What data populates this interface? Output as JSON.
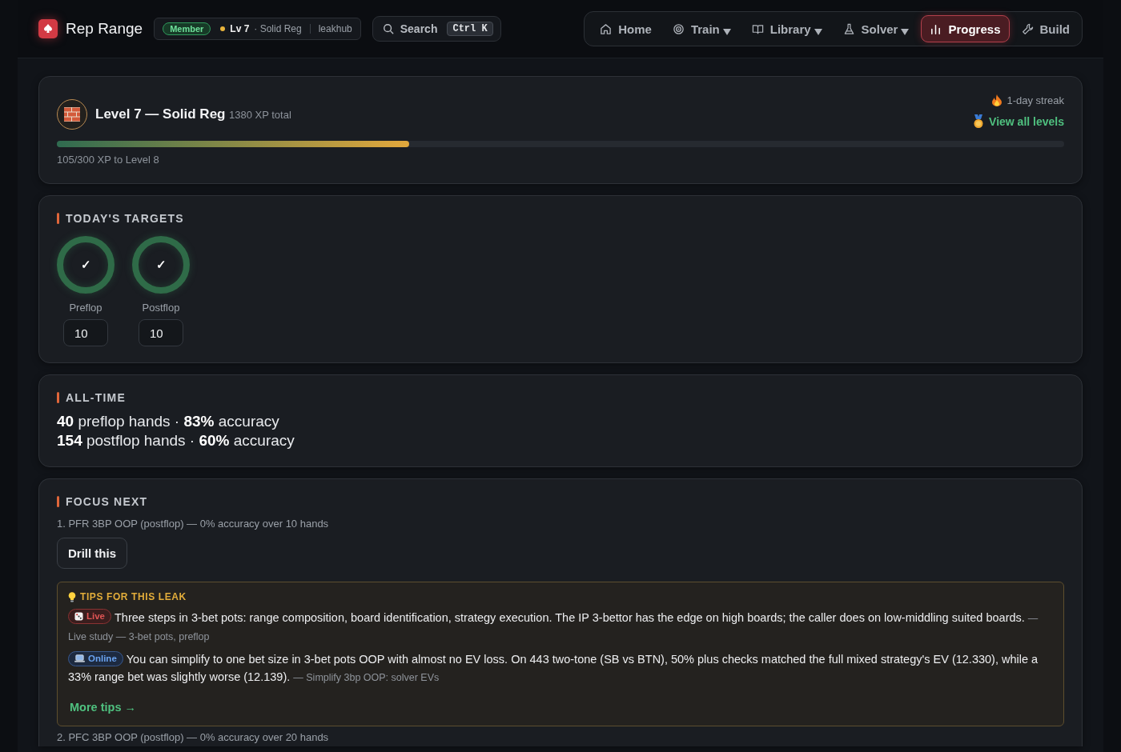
{
  "header": {
    "brand": "Rep Range",
    "badge": "Member",
    "level": "Lv 7",
    "rank": "· Solid Reg",
    "user": "leakhub",
    "search": {
      "label": "Search",
      "shortcut": "Ctrl K"
    },
    "nav": [
      {
        "label": "Home",
        "dropdown": false,
        "selected": false
      },
      {
        "label": "Train",
        "dropdown": true,
        "selected": false
      },
      {
        "label": "Library",
        "dropdown": true,
        "selected": false
      },
      {
        "label": "Solver",
        "dropdown": true,
        "selected": false
      },
      {
        "label": "Progress",
        "dropdown": false,
        "selected": true
      },
      {
        "label": "Build",
        "dropdown": false,
        "selected": false
      }
    ]
  },
  "level_card": {
    "title": "Level 7 — Solid Reg",
    "xp_total": "1380 XP total",
    "streak": "1-day streak",
    "link": "View all levels",
    "level": 0.35,
    "caption": "105/300 XP to Level 8"
  },
  "targets": {
    "title": "TODAY'S TARGETS",
    "items": [
      {
        "label": "Preflop",
        "mark": "✓",
        "level": 1,
        "value": "10"
      },
      {
        "label": "Postflop",
        "mark": "✓",
        "level": 1,
        "value": "10"
      }
    ]
  },
  "all_time": {
    "title": "ALL-TIME",
    "lines": [
      "**40** preflop hands · **83%** accuracy",
      "**154** postflop hands · **60%** accuracy"
    ]
  },
  "focus": {
    "title": "FOCUS NEXT",
    "items": [
      {
        "text": "1. PFR 3BP OOP (postflop) — 0% accuracy over 10 hands",
        "button": "Drill this",
        "tips": {
          "title": "TIPS FOR THIS LEAK",
          "items": [
            {
              "kind": "live",
              "tag": "Live",
              "text": "Three steps in 3-bet pots: range composition, board identification, strategy execution. The IP 3-bettor has the edge on high boards; the caller does on low-middling suited boards.",
              "source": "— Live study — 3-bet pots, preflop"
            },
            {
              "kind": "online",
              "tag": "Online",
              "text": "You can simplify to one bet size in 3-bet pots OOP with almost no EV loss. On 443 two-tone (SB vs BTN), 50% plus checks matched the full mixed strategy's EV (12.330), while a 33% range bet was slightly worse (12.139).",
              "source": "— Simplify 3bp OOP: solver EVs"
            }
          ],
          "more": "More tips →"
        }
      },
      {
        "text": "2. PFC 3BP OOP (postflop) — 0% accuracy over 20 hands"
      }
    ]
  }
}
